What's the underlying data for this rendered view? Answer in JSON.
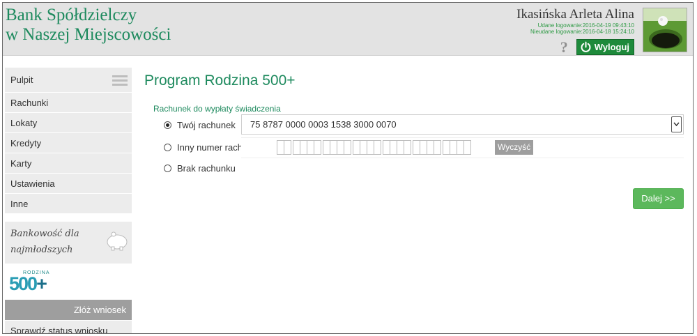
{
  "header": {
    "bank_name_line1": "Bank Spółdzielczy",
    "bank_name_line2": "w Naszej Miejscowości",
    "user_name": "Ikasińska Arleta Alina",
    "successful_login": "Udane logowanie:2016-04-19 09:43:10",
    "failed_login": "Nieudane logowanie:2016-04-18 15:24:10",
    "help_icon": "question-mark",
    "logout_label": "Wyloguj",
    "logout_icon": "power-icon"
  },
  "sidebar": {
    "items": [
      {
        "label": "Pulpit"
      },
      {
        "label": "Rachunki"
      },
      {
        "label": "Lokaty"
      },
      {
        "label": "Kredyty"
      },
      {
        "label": "Karty"
      },
      {
        "label": "Ustawienia"
      },
      {
        "label": "Inne"
      }
    ],
    "kids_banking_line1": "Bankowość dla",
    "kids_banking_line2": "najmłodszych",
    "logo_small": "RODZINA",
    "logo_big": "500",
    "logo_plus": "+",
    "submit_label": "Złóż wniosek",
    "status_label": "Sprawdź status wniosku"
  },
  "main": {
    "title": "Program Rodzina 500+",
    "section_label": "Rachunek do wypłaty świadczenia",
    "options": [
      {
        "label": "Twój rachunek",
        "checked": true
      },
      {
        "label": "Inny numer rachunku",
        "checked": false
      },
      {
        "label": "Brak rachunku",
        "checked": false
      }
    ],
    "selected_account": "75 8787 0000 0003 1538 3000 0070",
    "clear_label": "Wyczyść",
    "next_label": "Dalej >>"
  },
  "colors": {
    "brand_green": "#1e8a5e",
    "logout_green": "#1e8a3b",
    "next_button": "#5cb85c",
    "header_bg": "#e3e3e3",
    "sidebar_bg": "#ececec"
  }
}
